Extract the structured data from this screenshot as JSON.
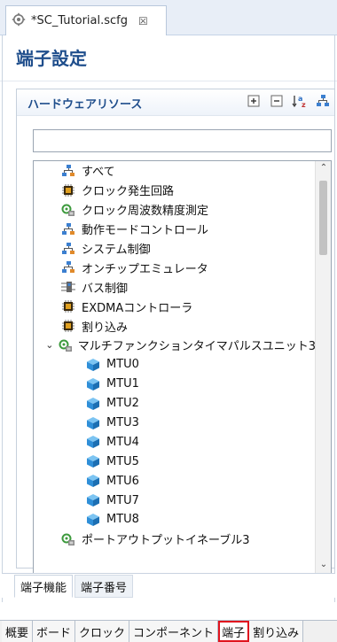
{
  "editor_tab": {
    "label": "*SC_Tutorial.scfg",
    "close_glyph": "☒"
  },
  "page": {
    "title": "端子設定"
  },
  "section": {
    "title": "ハードウェアリソース"
  },
  "filter": {
    "value": "",
    "placeholder": ""
  },
  "tree": {
    "items": [
      {
        "label": "すべて",
        "icon": "hierarchy-icon",
        "level": 0
      },
      {
        "label": "クロック発生回路",
        "icon": "chip-icon",
        "level": 0
      },
      {
        "label": "クロック周波数精度測定",
        "icon": "multi-peripheral-icon",
        "level": 0
      },
      {
        "label": "動作モードコントロール",
        "icon": "hierarchy-icon",
        "level": 0
      },
      {
        "label": "システム制御",
        "icon": "hierarchy-icon",
        "level": 0
      },
      {
        "label": "オンチップエミュレータ",
        "icon": "hierarchy-icon",
        "level": 0
      },
      {
        "label": "バス制御",
        "icon": "bus-icon",
        "level": 0
      },
      {
        "label": "EXDMAコントローラ",
        "icon": "chip-icon",
        "level": 0
      },
      {
        "label": "割り込み",
        "icon": "chip-icon",
        "level": 0
      },
      {
        "label": "マルチファンクションタイマパルスユニット3",
        "icon": "multi-peripheral-icon",
        "level": 0,
        "expanded": true
      },
      {
        "label": "MTU0",
        "icon": "cube-icon",
        "level": 1
      },
      {
        "label": "MTU1",
        "icon": "cube-icon",
        "level": 1
      },
      {
        "label": "MTU2",
        "icon": "cube-icon",
        "level": 1
      },
      {
        "label": "MTU3",
        "icon": "cube-icon",
        "level": 1
      },
      {
        "label": "MTU4",
        "icon": "cube-icon",
        "level": 1
      },
      {
        "label": "MTU5",
        "icon": "cube-icon",
        "level": 1
      },
      {
        "label": "MTU6",
        "icon": "cube-icon",
        "level": 1
      },
      {
        "label": "MTU7",
        "icon": "cube-icon",
        "level": 1
      },
      {
        "label": "MTU8",
        "icon": "cube-icon",
        "level": 1
      },
      {
        "label": "ポートアウトプットイネーブル3",
        "icon": "multi-peripheral-icon",
        "level": 0
      }
    ]
  },
  "inner_tabs": [
    {
      "label": "端子機能",
      "active": true
    },
    {
      "label": "端子番号",
      "active": false
    }
  ],
  "main_tabs": [
    {
      "label": "概要",
      "selected": false
    },
    {
      "label": "ボード",
      "selected": false
    },
    {
      "label": "クロック",
      "selected": false
    },
    {
      "label": "コンポーネント",
      "selected": false
    },
    {
      "label": "端子",
      "selected": true
    },
    {
      "label": "割り込み",
      "selected": false
    }
  ],
  "colors": {
    "title": "#1f4e8c",
    "selected_outline": "#e0141e",
    "cube": "#2f8fd8"
  }
}
